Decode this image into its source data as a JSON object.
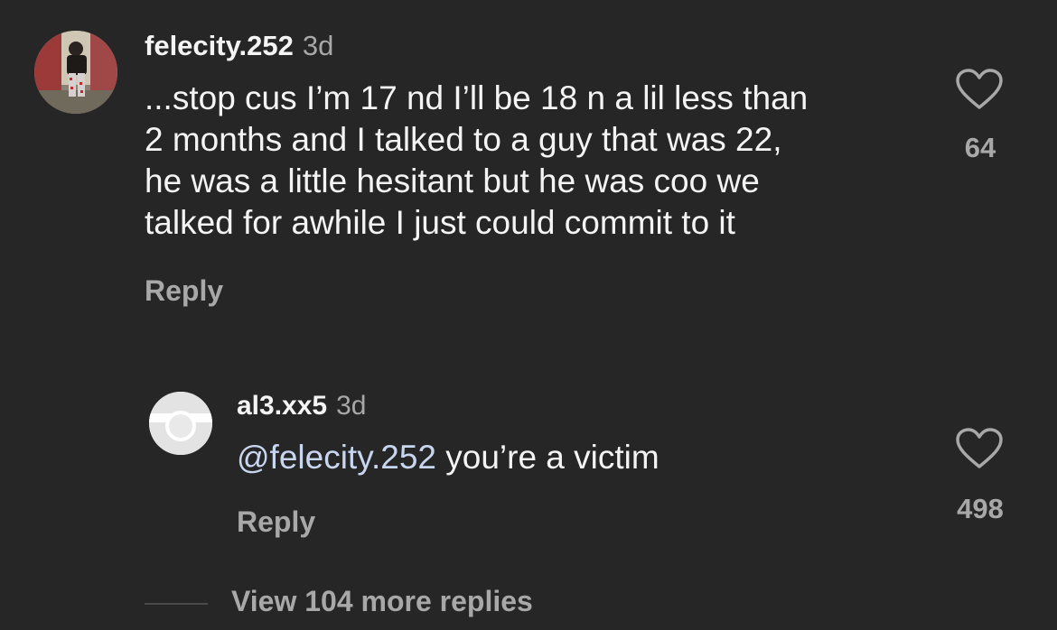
{
  "comment": {
    "username": "felecity.252",
    "time": "3d",
    "text": "...stop cus I’m 17 nd I’ll be 18 n a lil less than\n2 months and I talked to a guy that was 22,\nhe was a little hesitant but he was coo we\ntalked for awhile I just could commit to it",
    "reply_label": "Reply",
    "likes": "64",
    "like_icon": "heart-outline-icon"
  },
  "reply": {
    "username": "al3.xx5",
    "time": "3d",
    "mention_icon": "@",
    "mention": "felecity.252",
    "text": " you’re a victim",
    "reply_label": "Reply",
    "likes": "498",
    "like_icon": "heart-outline-icon"
  },
  "view_more": "View 104 more replies",
  "colors": {
    "background": "#262626",
    "primary_text": "#f4f4f4",
    "secondary_text": "#a8a8a8",
    "mention": "#c8d6f0"
  }
}
